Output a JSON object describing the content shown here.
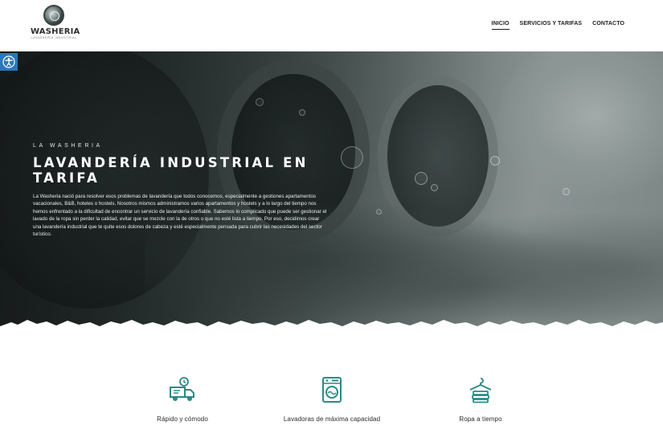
{
  "header": {
    "logo": {
      "word": "WASHERIA",
      "tagline": "LAVANDERÍA INDUSTRIAL"
    },
    "nav": [
      {
        "label": "INICIO",
        "active": true
      },
      {
        "label": "SERVICIOS Y TARIFAS",
        "active": false
      },
      {
        "label": "CONTACTO",
        "active": false
      }
    ]
  },
  "accessibility": {
    "icon": "accessibility-icon",
    "color": "#2a78b8"
  },
  "hero": {
    "kicker": "LA WASHERIA",
    "title": "LAVANDERÍA INDUSTRIAL EN TARIFA",
    "text": "La Washeria nació para resolver esos problemas de lavandería que todos conocemos, especialmente a gestiones apartamentos vacacionales, B&B, hoteles o hostels. Nosotros mismos administramos varios apartamentos y hostels y a lo largo del tiempo nos hemos enfrentado a la dificultad de encontrar un servicio de lavandería confiable. Sabemos lo complicado que puede ser gestionar el lavado de la ropa sin perder la calidad, evitar que se mezcle con la de otros o que no esté lista a tiempo. Por eso, decidimos crear una lavandería industrial que te quite esos dolores de cabeza y esté especialmente pensada para cubrir las necesidades del sector turístico."
  },
  "features": [
    {
      "icon": "delivery-truck-clock-icon",
      "label": "Rápido y cómodo"
    },
    {
      "icon": "washing-machine-icon",
      "label": "Lavadoras de máxima capacidad"
    },
    {
      "icon": "folded-clothes-hanger-icon",
      "label": "Ropa a tiempo"
    }
  ],
  "colors": {
    "accent": "#2a8a86",
    "text": "#1d1d1d",
    "hero_text": "#ffffff"
  }
}
